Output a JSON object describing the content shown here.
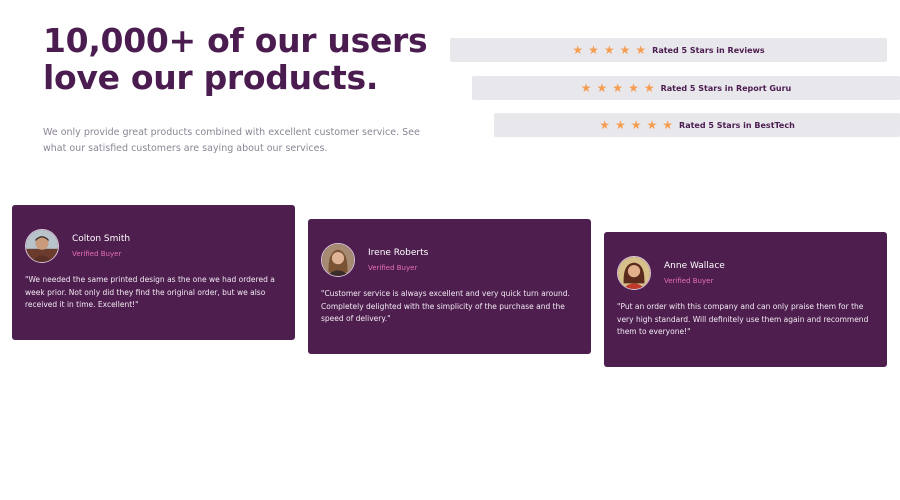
{
  "hero": {
    "headline_line1": "10,000+ of our users",
    "headline_line2": "love our products.",
    "description": "We only provide great products combined with excellent customer service. See what our satisfied customers are saying about our services."
  },
  "ratings": [
    {
      "stars": 5,
      "text": "Rated 5 Stars in Reviews"
    },
    {
      "stars": 5,
      "text": "Rated 5 Stars in Report Guru"
    },
    {
      "stars": 5,
      "text": "Rated 5 Stars in BestTech"
    }
  ],
  "testimonials": [
    {
      "name": "Colton Smith",
      "role": "Verified Buyer",
      "quote": "\"We needed the same printed design as the one we had ordered a week prior. Not only did they find the original order, but we also received it in time. Excellent!\""
    },
    {
      "name": "Irene Roberts",
      "role": "Verified Buyer",
      "quote": "\"Customer service is always excellent and very quick turn around. Completely delighted with the simplicity of the purchase and the speed of delivery.\""
    },
    {
      "name": "Anne Wallace",
      "role": "Verified Buyer",
      "quote": "\"Put an order with this company and can only praise them for the very high standard. Will definitely use them again and recommend them to everyone!\""
    }
  ],
  "icons": {
    "star": "star-icon",
    "avatar": "user-photo"
  },
  "colors": {
    "heading": "#4b1c4f",
    "card_background": "#4d1e4e",
    "star": "#f59e52",
    "rating_background": "#e8e7ec",
    "role_text": "#e86fb8"
  }
}
